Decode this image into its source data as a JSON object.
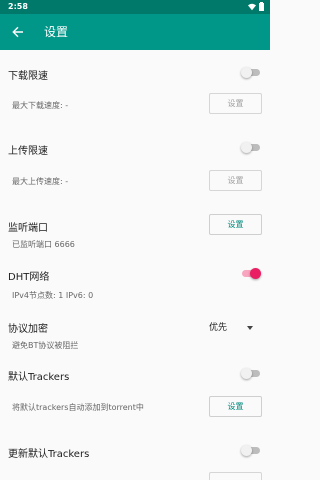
{
  "status_bar": {
    "time": "2:58"
  },
  "app_bar": {
    "title": "设置"
  },
  "settings": {
    "download_limit": {
      "label": "下载限速",
      "sub": "最大下载速度: -",
      "button": "设置"
    },
    "upload_limit": {
      "label": "上传限速",
      "sub": "最大上传速度: -",
      "button": "设置"
    },
    "listen_port": {
      "label": "监听端口",
      "sub": "已监听端口 6666",
      "button": "设置"
    },
    "dht": {
      "label": "DHT网络",
      "sub": "IPv4节点数: 1 IPv6: 0",
      "enabled": true
    },
    "encryption": {
      "label": "协议加密",
      "sub": "避免BT协议被阻拦",
      "selected": "优先"
    },
    "default_trackers": {
      "label": "默认Trackers",
      "sub": "将默认trackers自动添加到torrent中",
      "button": "设置"
    },
    "update_trackers": {
      "label": "更新默认Trackers"
    }
  },
  "colors": {
    "appbar": "#009688",
    "statusbar": "#00796b",
    "accent": "#e91e63",
    "button_text": "#00897b"
  }
}
